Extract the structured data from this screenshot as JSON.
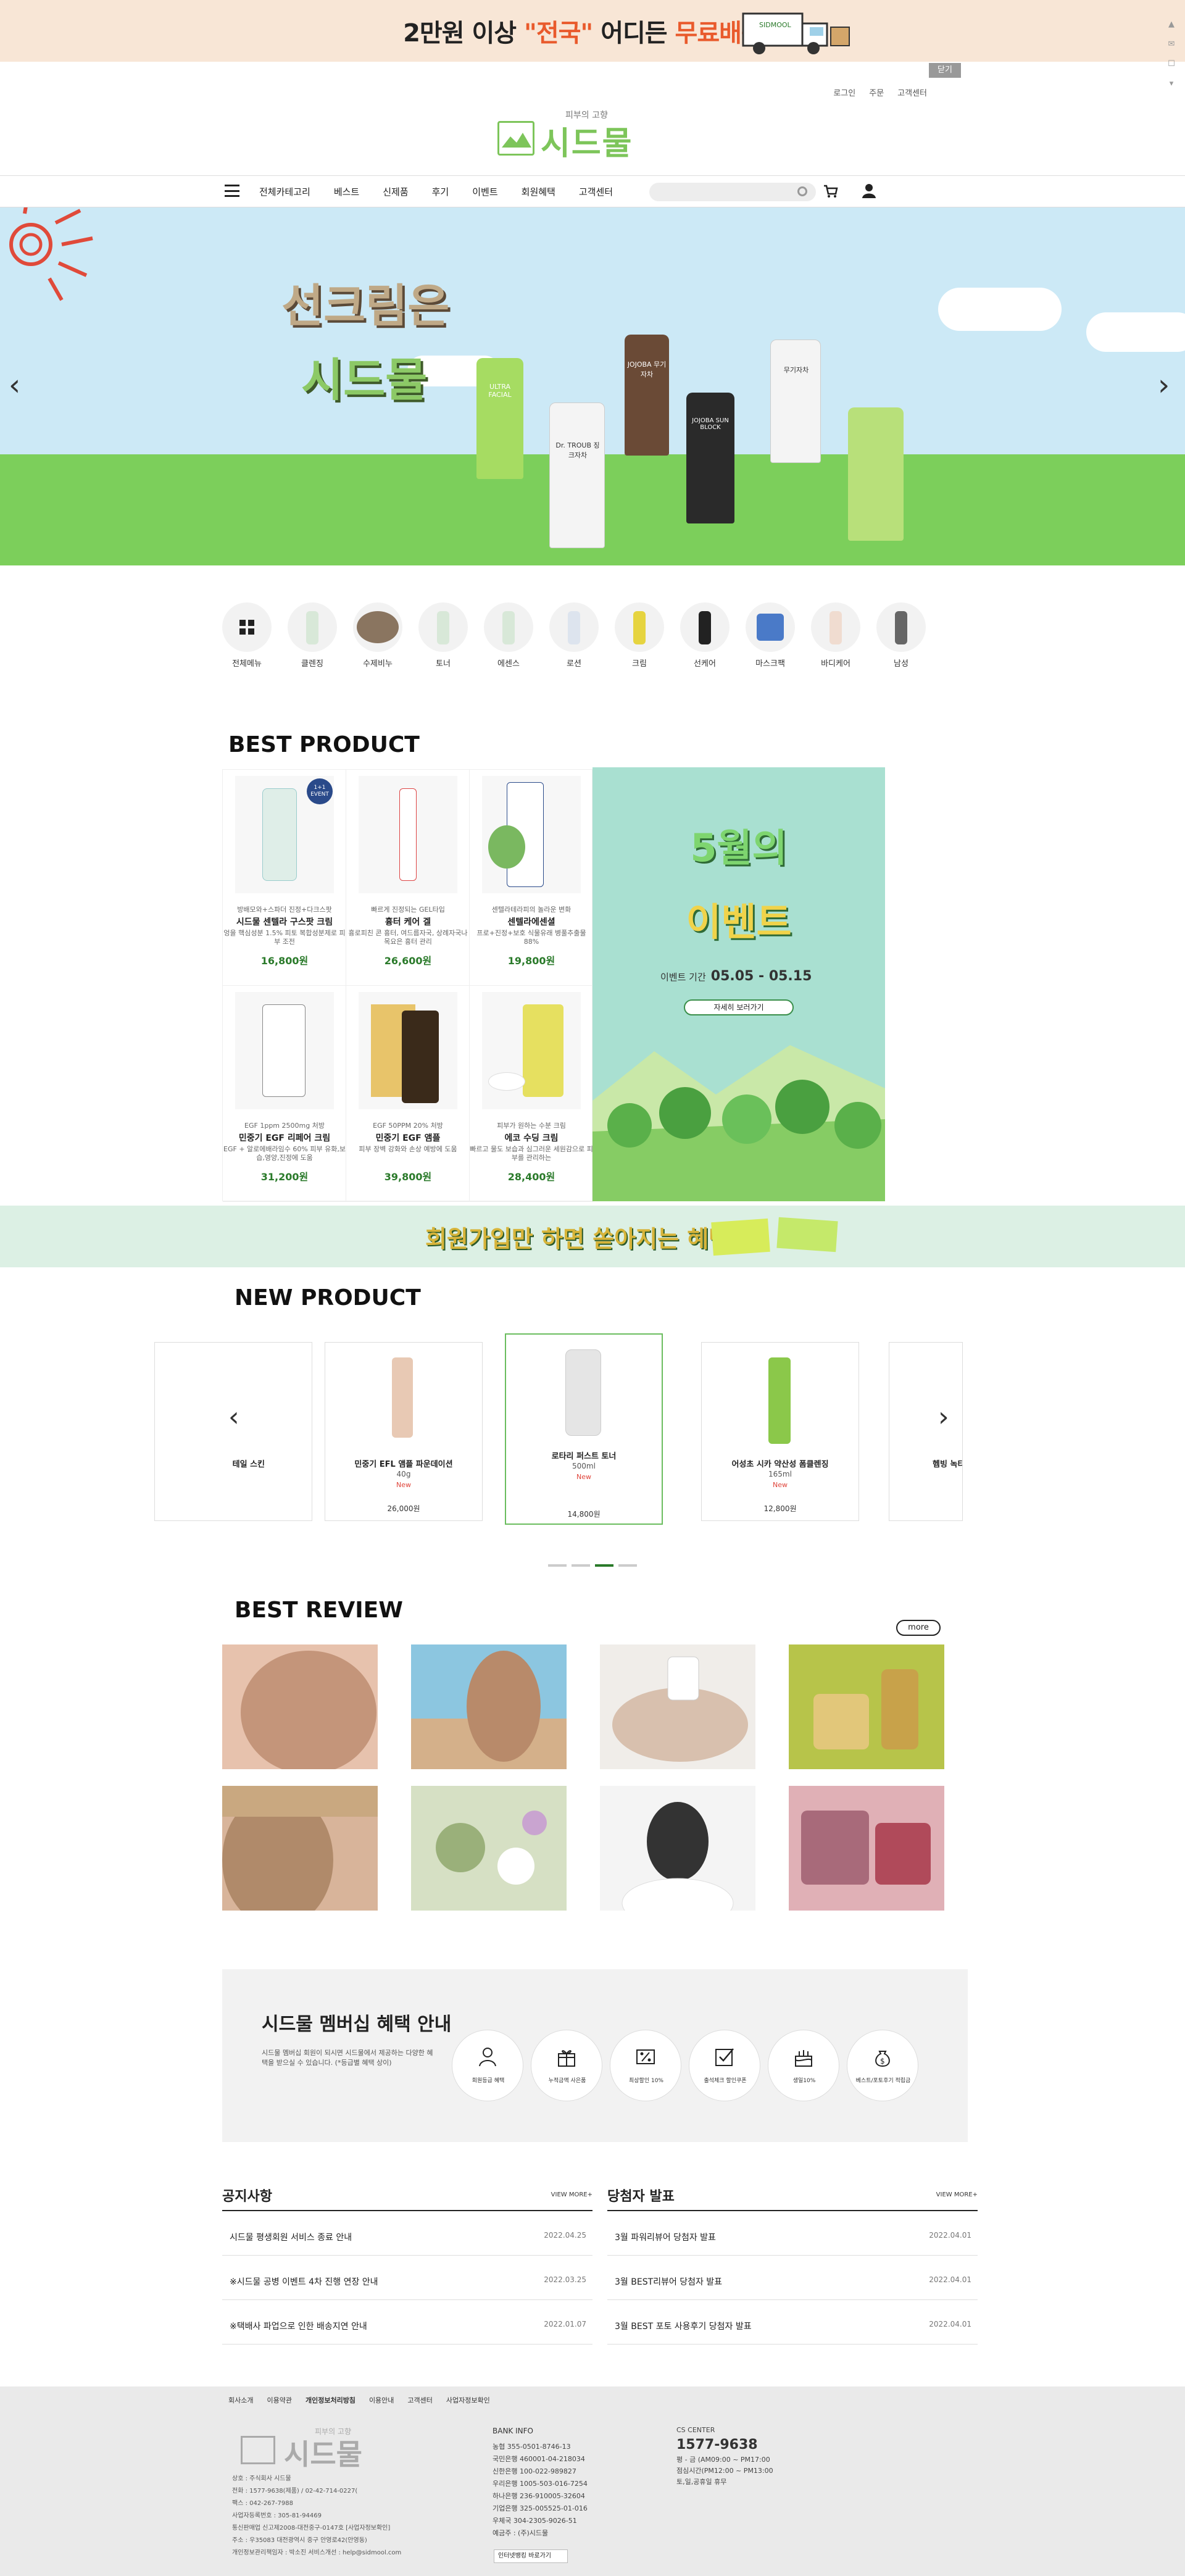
{
  "top_banner": {
    "text_a": "2만원 이상 ",
    "text_b": "\"전국\"",
    "text_c": " 어디든 ",
    "text_d": "무료배송 !",
    "close": "닫기",
    "truck_label": "SIDMOOL"
  },
  "top_links": [
    "로그인",
    "주문",
    "고객센터"
  ],
  "logo": {
    "sub": "피부의 고향",
    "main": "시드물"
  },
  "nav": {
    "items": [
      "전체카테고리",
      "베스트",
      "신제품",
      "후기",
      "이벤트",
      "회원혜택",
      "고객센터"
    ],
    "search_placeholder": ""
  },
  "hero": {
    "title1": "선크림은",
    "title2": "시드물",
    "prev": "‹",
    "next": "›",
    "tubes": [
      {
        "label": "ULTRA FACIAL",
        "color": "#a6dc62"
      },
      {
        "label": "Dr. TROUB 징크자차",
        "color": "#f4f4f4"
      },
      {
        "label": "JOJOBA 무기자차",
        "color": "#6a4a36"
      },
      {
        "label": "JOJOBA SUN BLOCK",
        "color": "#2a2a2a"
      },
      {
        "label": "무기자차",
        "color": "#f4f4f4"
      },
      {
        "label": "",
        "color": "#b8e07a"
      }
    ]
  },
  "categories": [
    {
      "label": "전체메뉴",
      "icon": "grid-icon"
    },
    {
      "label": "클렌징"
    },
    {
      "label": "수제비누"
    },
    {
      "label": "토너"
    },
    {
      "label": "에센스"
    },
    {
      "label": "로션"
    },
    {
      "label": "크림"
    },
    {
      "label": "선케어"
    },
    {
      "label": "마스크팩"
    },
    {
      "label": "바디케어"
    },
    {
      "label": "남성"
    }
  ],
  "best": {
    "title": "BEST PRODUCT",
    "products": [
      {
        "d1": "방배모와+스파더 진정+다크스팟",
        "name": "시드물 센텔라 구스팟 크림",
        "d2": "엉을 핵심성분 1.5%\n피토 복합성분제로 피부 조전",
        "price": "16,800원",
        "badge": "1+1 EVENT",
        "color": "#dfeee8"
      },
      {
        "d1": "빠르게 진정되는 GEL타입",
        "name": "흉터 케어 겔",
        "d2": "흉로피친 콘 흉터, 여드름자국,\n상례자국나 목요은 흉터 관리",
        "price": "26,600원",
        "color": "#f3e3e3"
      },
      {
        "d1": "센텔라테라피의 놀라운 변화",
        "name": "센텔라에센셜",
        "d2": "프로+진정+보호\n식물유래 병풀추출물 88%",
        "price": "19,800원",
        "color": "#e5f0e0"
      },
      {
        "d1": "EGF 1ppm 2500mg 처방",
        "name": "민중기 EGF 리페어 크림",
        "d2": "EGF + 알로에배라임수 60%\n피부 유화,보습,영양,진정에 도움",
        "price": "31,200원",
        "color": "#f1f1f1"
      },
      {
        "d1": "EGF 50PPM 20% 처방",
        "name": "민중기 EGF 앰플",
        "d2": "피부 장벽 강화와\n손상 예방에 도움",
        "price": "39,800원",
        "color": "#f7ecd7"
      },
      {
        "d1": "피부가 원하는 수분 크림",
        "name": "에코 수딩 크림",
        "d2": "빠르고 물도 보습과 심그러운\n세원감으로 피부를 관리하는",
        "price": "28,400원",
        "color": "#eef5d8"
      }
    ]
  },
  "event": {
    "l1": "5월의",
    "l2": "이벤트",
    "period_label": "이벤트 기간",
    "period": "05.05 - 05.15",
    "button": "자세히 보러가기"
  },
  "member_bar": {
    "text": "회원가입만 하면 쏟아지는 혜택 !!"
  },
  "new_product": {
    "title": "NEW PRODUCT",
    "prev": "‹",
    "next": "›",
    "items": [
      {
        "name": "테일 스킨",
        "vol": "",
        "new": "",
        "old": "",
        "price": "",
        "color": "#e0eede"
      },
      {
        "name": "민중기 EFL 앰플 파운데이션",
        "vol": "40g",
        "new": "New",
        "old": "",
        "price": "26,000원",
        "color": "#e8c9b4"
      },
      {
        "name": "로타리 퍼스트 토너",
        "vol": "500ml",
        "new": "New",
        "old": "",
        "price": "14,800원",
        "color": "#e5e5e5"
      },
      {
        "name": "어성초 시카 약산성 폼클렌징",
        "vol": "165ml",
        "new": "New",
        "old": "",
        "price": "12,800원",
        "color": "#8bc84a"
      },
      {
        "name": "헴빙 녹티",
        "vol": "",
        "new": "",
        "old": "",
        "price": "",
        "color": "#e6e6e6"
      }
    ]
  },
  "review": {
    "title": "BEST REVIEW",
    "more": "more",
    "images": [
      {
        "desc": "skin-closeup",
        "c1": "#e7c2ad",
        "c2": "#c4957a"
      },
      {
        "desc": "beach-sunscreen",
        "c1": "#8cc6e0",
        "c2": "#d4b08a"
      },
      {
        "desc": "hands-lotion",
        "c1": "#f0ede9",
        "c2": "#d8c0ae"
      },
      {
        "desc": "oil-jars",
        "c1": "#b7c44a",
        "c2": "#e2c77a"
      },
      {
        "desc": "acne-skin",
        "c1": "#d8b49a",
        "c2": "#b08a6a"
      },
      {
        "desc": "soap-flowers",
        "c1": "#d6e0c4",
        "c2": "#9ab07a"
      },
      {
        "desc": "black-mask",
        "c1": "#f4f4f4",
        "c2": "#333333"
      },
      {
        "desc": "handmade-soap",
        "c1": "#a86a7a",
        "c2": "#e0b0b6"
      }
    ]
  },
  "membership": {
    "title": "시드물 멤버십 혜택 안내",
    "desc": "시드물 멤버십 회원이 되시면 시드물에서 제공하는 다양한 혜택을 받으실 수 있습니다. (*등급별 혜택 상이)",
    "benefits": [
      {
        "label": "회원등급 혜택",
        "icon": "person-icon"
      },
      {
        "label": "누적금액 사은품",
        "icon": "gift-icon"
      },
      {
        "label": "최상할인 10%",
        "icon": "percent-icon"
      },
      {
        "label": "출석체크 할인쿠폰",
        "icon": "check-icon"
      },
      {
        "label": "생일10%",
        "icon": "cake-icon"
      },
      {
        "label": "베스트/포토후기 적립금",
        "icon": "money-icon"
      }
    ]
  },
  "notice": {
    "title": "공지사항",
    "view_more": "VIEW MORE+",
    "rows": [
      {
        "title": "시드물 평생회원 서비스 종료 안내",
        "date": "2022.04.25"
      },
      {
        "title": "※시드물 공병 이벤트 4차 진행 연장 안내",
        "date": "2022.03.25"
      },
      {
        "title": "※택배사 파업으로 인한 배송지연 안내",
        "date": "2022.01.07"
      }
    ]
  },
  "winners": {
    "title": "당첨자 발표",
    "view_more": "VIEW MORE+",
    "rows": [
      {
        "title": "3월 파워리뷰어 당첨자 발표",
        "date": "2022.04.01"
      },
      {
        "title": "3월 BEST리뷰어 당첨자 발표",
        "date": "2022.04.01"
      },
      {
        "title": "3월 BEST 포토 사용후기 당첨자 발표",
        "date": "2022.04.01"
      }
    ]
  },
  "footer": {
    "links": [
      "회사소개",
      "이용약관",
      "개인정보처리방침",
      "이용안내",
      "고객센터",
      "사업자정보확인"
    ],
    "logo_sub": "피부의 고향",
    "logo_main": "시드물",
    "info": [
      "상호 : 주식회사 시드물",
      "전화 : 1577-9638(제품) / 02-42-714-0227(",
      "팩스 : 042-267-7988",
      "사업자등록번호 : 305-81-94469",
      "통신판매업 신고제2008-대전중구-0147호 [사업자정보확인]",
      "주소 : 우35083 대전광역시 중구 안영로42(안영동)",
      "개인정보관리책임자 : 박소진 서비스개선 : help@sidmool.com"
    ],
    "bank_title": "BANK INFO",
    "bank": [
      "농협 355-0501-8746-13",
      "국민은행 460001-04-218034",
      "신한은행 100-022-989827",
      "우리은행 1005-503-016-7254",
      "하나은행 236-910005-32604",
      "기업은행 325-005525-01-016",
      "우체국 304-2305-9026-51",
      "예금주 : (주)시드물"
    ],
    "cs_title": "CS CENTER",
    "cs_phone": "1577-9638",
    "cs": [
      "평 - 금 (AM09:00 ~ PM17:00",
      "점심시간(PM12:00 ~ PM13:00",
      "토,일,공휴일 휴무"
    ],
    "select": "인터넷뱅킹 바로가기"
  },
  "side_controls": [
    "▲",
    "✉",
    "☐",
    "▾"
  ]
}
